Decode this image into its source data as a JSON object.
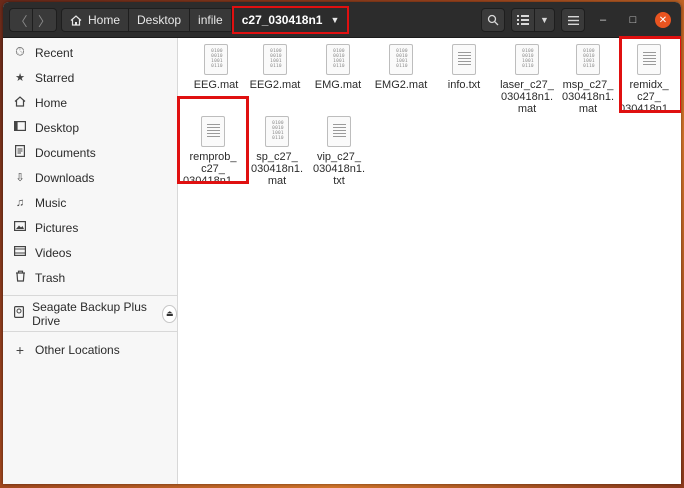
{
  "window": {
    "title": "c27_030418n1"
  },
  "header": {
    "back_label": "〈",
    "forward_label": "〉",
    "breadcrumbs": [
      {
        "label": "Home",
        "icon": "home-icon"
      },
      {
        "label": "Desktop"
      },
      {
        "label": "infile"
      },
      {
        "label": "c27_030418n1",
        "current": true
      }
    ],
    "search_icon": "search-icon",
    "view_icon": "list-view-icon",
    "menu_icon": "hamburger-icon",
    "minimize_label": "–",
    "maximize_label": "□",
    "close_label": "✕"
  },
  "sidebar": {
    "items": [
      {
        "label": "Recent",
        "icon": "clock-icon"
      },
      {
        "label": "Starred",
        "icon": "star-icon"
      },
      {
        "label": "Home",
        "icon": "home-icon"
      },
      {
        "label": "Desktop",
        "icon": "desktop-icon"
      },
      {
        "label": "Documents",
        "icon": "documents-icon"
      },
      {
        "label": "Downloads",
        "icon": "download-icon"
      },
      {
        "label": "Music",
        "icon": "music-icon"
      },
      {
        "label": "Pictures",
        "icon": "pictures-icon"
      },
      {
        "label": "Videos",
        "icon": "videos-icon"
      },
      {
        "label": "Trash",
        "icon": "trash-icon"
      }
    ],
    "devices": [
      {
        "label": "Seagate Backup Plus Drive",
        "icon": "drive-icon"
      }
    ],
    "other": {
      "label": "Other Locations",
      "icon": "plus-icon"
    }
  },
  "files": [
    {
      "name": "EEG.mat",
      "kind": "binary"
    },
    {
      "name": "EEG2.mat",
      "kind": "binary"
    },
    {
      "name": "EMG.mat",
      "kind": "binary"
    },
    {
      "name": "EMG2.mat",
      "kind": "binary"
    },
    {
      "name": "info.txt",
      "kind": "text"
    },
    {
      "name": "laser_c27_ 030418n1. mat",
      "kind": "binary"
    },
    {
      "name": "msp_c27_ 030418n1. mat",
      "kind": "binary"
    },
    {
      "name": "remidx_ c27_ 030418n1…",
      "kind": "text"
    },
    {
      "name": "remprob_ c27_ 030418n1…",
      "kind": "text"
    },
    {
      "name": "sp_c27_ 030418n1. mat",
      "kind": "binary"
    },
    {
      "name": "vip_c27_ 030418n1. txt",
      "kind": "text"
    }
  ],
  "binary_glyph": [
    "0100",
    "0010",
    "1001",
    "0110"
  ],
  "colors": {
    "highlight": "#e01010",
    "close": "#e95420",
    "header": "#2c2c2c"
  }
}
